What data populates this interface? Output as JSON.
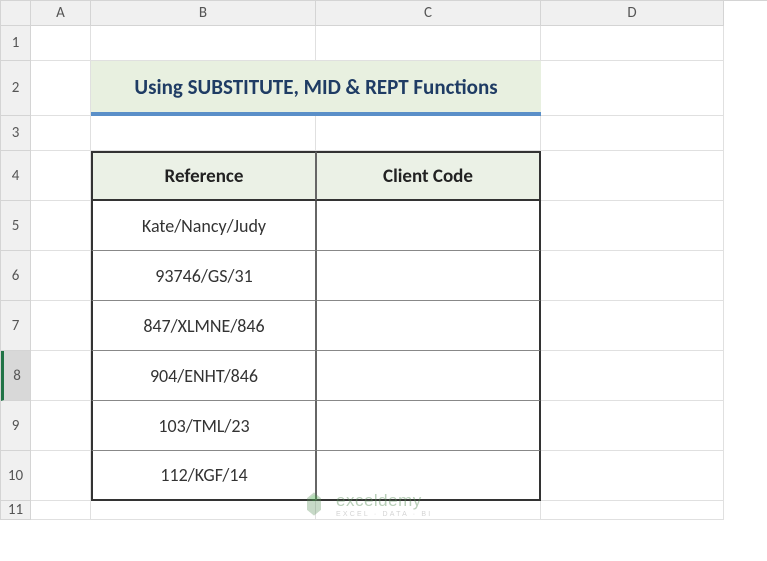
{
  "columns": [
    "A",
    "B",
    "C",
    "D"
  ],
  "rows": [
    "1",
    "2",
    "3",
    "4",
    "5",
    "6",
    "7",
    "8",
    "9",
    "10",
    "11"
  ],
  "selected_row": "8",
  "title": "Using SUBSTITUTE, MID & REPT Functions",
  "headers": {
    "reference": "Reference",
    "clientcode": "Client Code"
  },
  "data": [
    {
      "reference": "Kate/Nancy/Judy",
      "clientcode": ""
    },
    {
      "reference": "93746/GS/31",
      "clientcode": ""
    },
    {
      "reference": "847/XLMNE/846",
      "clientcode": ""
    },
    {
      "reference": "904/ENHT/846",
      "clientcode": ""
    },
    {
      "reference": "103/TML/23",
      "clientcode": ""
    },
    {
      "reference": "112/KGF/14",
      "clientcode": ""
    }
  ],
  "watermark": {
    "main": "exceldemy",
    "sub": "EXCEL · DATA · BI"
  }
}
